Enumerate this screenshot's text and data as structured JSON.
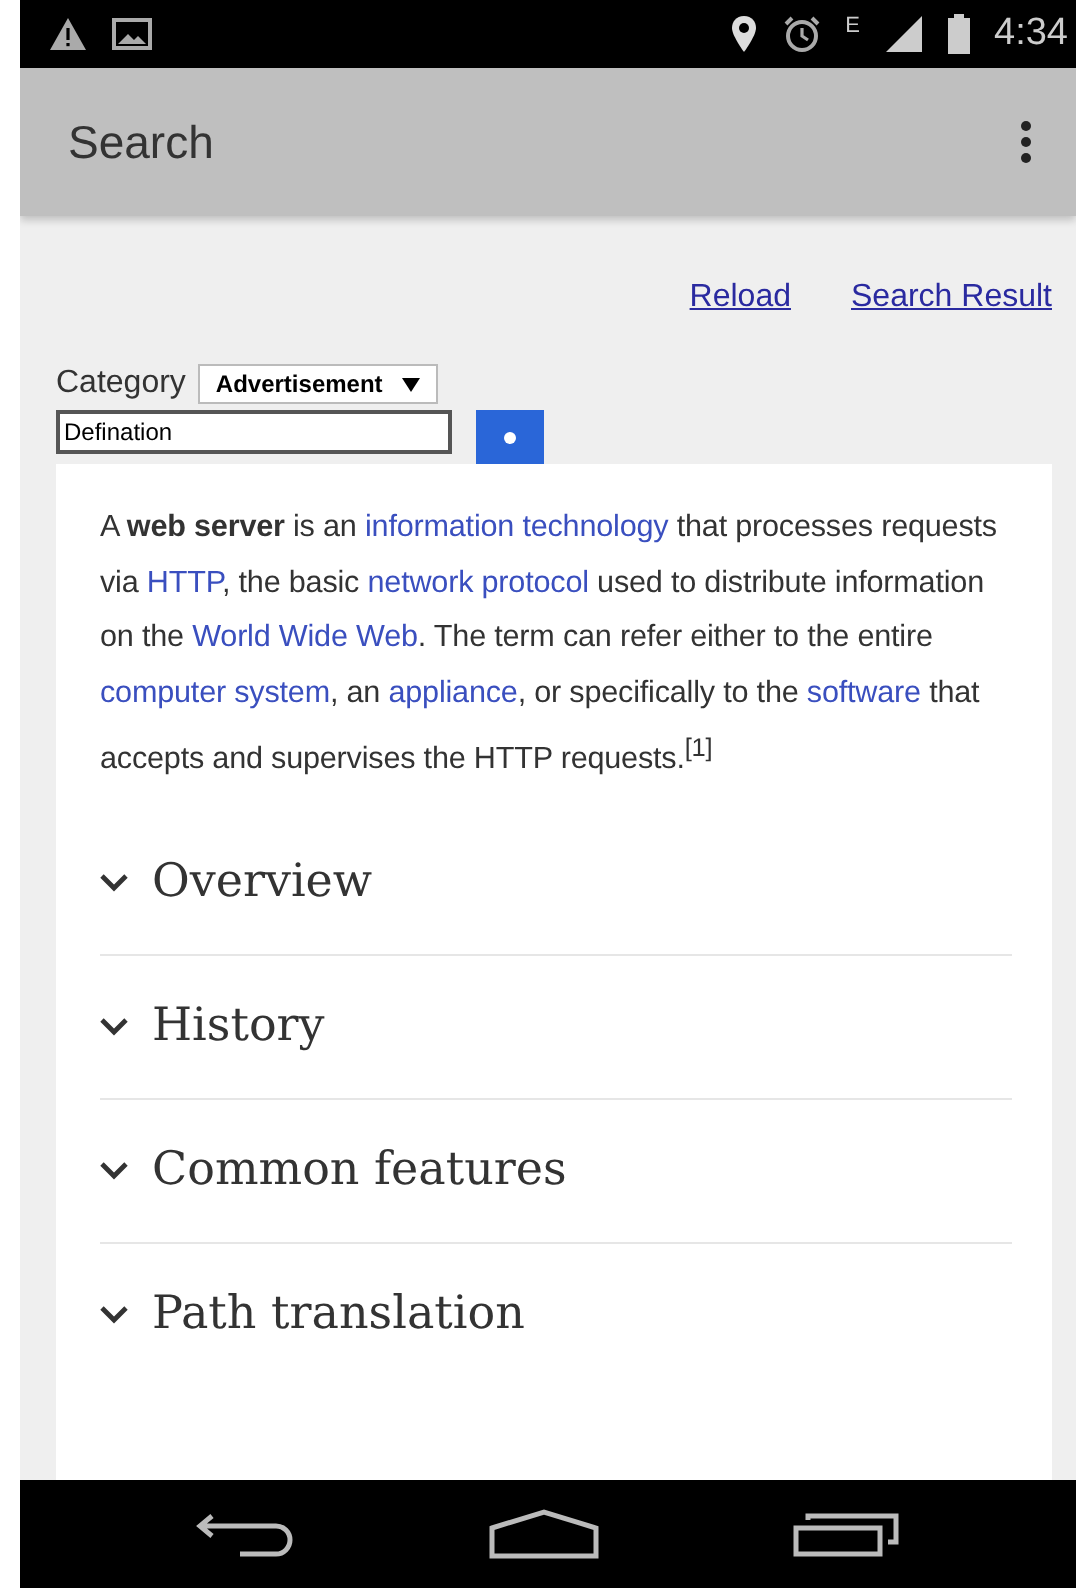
{
  "status_bar": {
    "network": "E",
    "time": "4:34"
  },
  "app_bar": {
    "title": "Search"
  },
  "links": [
    "Reload",
    "Search Result"
  ],
  "category": {
    "label": "Category",
    "value": "Advertisement"
  },
  "search": {
    "value": "Defination"
  },
  "article": {
    "paragraph": [
      {
        "kind": "text",
        "text": "A **web server** is an "
      },
      {
        "kind": "link",
        "text": "information technology"
      },
      {
        "kind": "text",
        "text": " that processes requests via "
      },
      {
        "kind": "link",
        "text": "HTTP"
      },
      {
        "kind": "text",
        "text": ", the basic "
      },
      {
        "kind": "link",
        "text": "network protocol"
      },
      {
        "kind": "text",
        "text": " used to distribute information on the "
      },
      {
        "kind": "link",
        "text": "World Wide Web"
      },
      {
        "kind": "text",
        "text": ". The term can refer either to the entire "
      },
      {
        "kind": "link",
        "text": "computer system"
      },
      {
        "kind": "text",
        "text": ", an "
      },
      {
        "kind": "link",
        "text": "appliance"
      },
      {
        "kind": "text",
        "text": ", or specifically to the "
      },
      {
        "kind": "link",
        "text": "software"
      },
      {
        "kind": "text",
        "text": " that accepts and supervises the HTTP requests.$^{[1]}$"
      }
    ],
    "sections": [
      {
        "title": "Overview",
        "expanded": false
      },
      {
        "title": "History",
        "expanded": false
      },
      {
        "title": "Common features",
        "expanded": false
      },
      {
        "title": "Path translation",
        "expanded": false
      }
    ]
  }
}
